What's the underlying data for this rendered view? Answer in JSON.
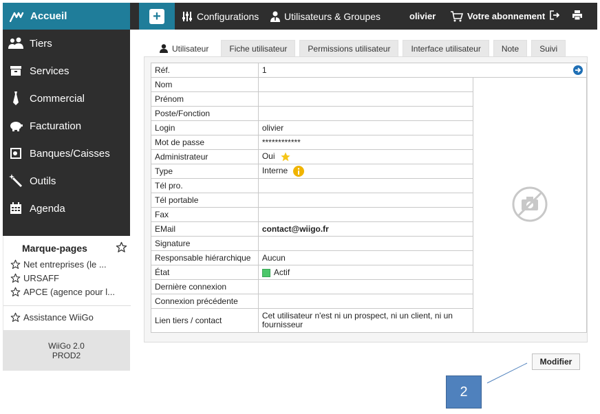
{
  "brand": {
    "label": "Accueil"
  },
  "topnav": {
    "configurations": "Configurations",
    "users_groups": "Utilisateurs & Groupes",
    "username": "olivier",
    "subscription": "Votre abonnement"
  },
  "sidebar": {
    "items": [
      {
        "label": "Tiers",
        "icon": "users-icon"
      },
      {
        "label": "Services",
        "icon": "box-icon"
      },
      {
        "label": "Commercial",
        "icon": "tie-icon"
      },
      {
        "label": "Facturation",
        "icon": "piggy-bank-icon"
      },
      {
        "label": "Banques/Caisses",
        "icon": "safe-icon"
      },
      {
        "label": "Outils",
        "icon": "magic-wand-icon"
      },
      {
        "label": "Agenda",
        "icon": "calendar-icon"
      }
    ]
  },
  "bookmarks": {
    "title": "Marque-pages",
    "items": [
      {
        "label": "Net entreprises (le ..."
      },
      {
        "label": "URSAFF"
      },
      {
        "label": "APCE (agence pour l..."
      },
      {
        "label": "Assistance WiiGo"
      }
    ]
  },
  "version": {
    "line1": "WiiGo 2.0",
    "line2": "PROD2"
  },
  "tabs": [
    {
      "label": "Utilisateur",
      "active": true
    },
    {
      "label": "Fiche utilisateur"
    },
    {
      "label": "Permissions utilisateur"
    },
    {
      "label": "Interface utilisateur"
    },
    {
      "label": "Note"
    },
    {
      "label": "Suivi"
    }
  ],
  "fields": {
    "ref": {
      "label": "Réf.",
      "value": "1"
    },
    "nom": {
      "label": "Nom",
      "value": ""
    },
    "prenom": {
      "label": "Prénom",
      "value": ""
    },
    "poste": {
      "label": "Poste/Fonction",
      "value": ""
    },
    "login": {
      "label": "Login",
      "value": "olivier"
    },
    "password": {
      "label": "Mot de passe",
      "value": "************"
    },
    "admin": {
      "label": "Administrateur",
      "value": "Oui"
    },
    "type": {
      "label": "Type",
      "value": "Interne"
    },
    "tel_pro": {
      "label": "Tél pro.",
      "value": ""
    },
    "tel_portable": {
      "label": "Tél portable",
      "value": ""
    },
    "fax": {
      "label": "Fax",
      "value": ""
    },
    "email": {
      "label": "EMail",
      "value": "contact@wiigo.fr"
    },
    "signature": {
      "label": "Signature",
      "value": ""
    },
    "manager": {
      "label": "Responsable hiérarchique",
      "value": "Aucun"
    },
    "etat": {
      "label": "État",
      "value": "Actif",
      "color": "#4cc76a"
    },
    "last_login": {
      "label": "Dernière connexion",
      "value": ""
    },
    "prev_login": {
      "label": "Connexion précédente",
      "value": ""
    },
    "link": {
      "label": "Lien tiers / contact",
      "value": "Cet utilisateur n'est ni un prospect, ni un client, ni un fournisseur"
    }
  },
  "actions": {
    "modify": "Modifier"
  },
  "callout": {
    "number": "2"
  },
  "colors": {
    "brand": "#1f7d9a",
    "nav_bg": "#2e2e2e",
    "callout": "#4f81bd",
    "accent_star": "#f5c518",
    "info": "#f0b400"
  }
}
